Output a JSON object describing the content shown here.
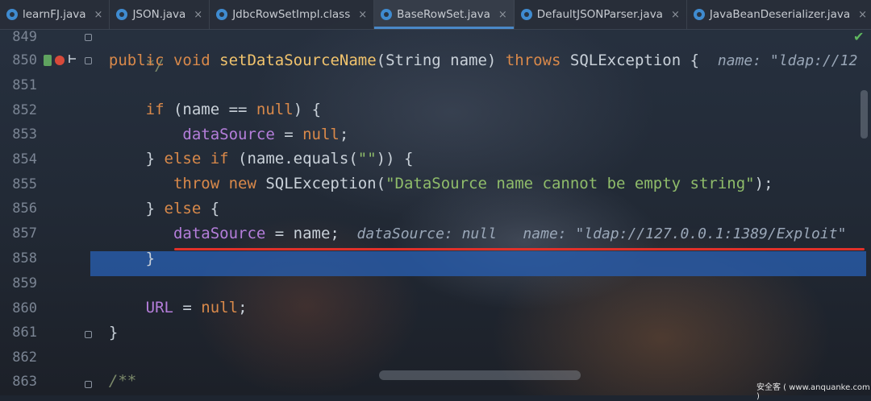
{
  "tabs": [
    {
      "label": "learnFJ.java",
      "active": false
    },
    {
      "label": "JSON.java",
      "active": false
    },
    {
      "label": "JdbcRowSetImpl.class",
      "active": false
    },
    {
      "label": "BaseRowSet.java",
      "active": true
    },
    {
      "label": "DefaultJSONParser.java",
      "active": false
    },
    {
      "label": "JavaBeanDeserializer.java",
      "active": false
    }
  ],
  "tab_close_glyph": "×",
  "line_numbers": [
    "849",
    "850",
    "851",
    "852",
    "853",
    "854",
    "855",
    "856",
    "857",
    "858",
    "859",
    "860",
    "861",
    "862",
    "863"
  ],
  "code": {
    "l849": "*/",
    "l850": {
      "kw1": "public void ",
      "fn": "setDataSourceName",
      "rest1": "(String name) ",
      "kw2": "throws ",
      "rest2": "SQLException {  ",
      "hint": "name: \"ldap://12"
    },
    "l852": {
      "kw": "if ",
      "a": "(name == ",
      "kw2": "null",
      "b": ") {"
    },
    "l853": {
      "fld": "dataSource",
      "a": " = ",
      "kw": "null",
      "b": ";"
    },
    "l854": {
      "a": "} ",
      "kw": "else if ",
      "b": "(name.equals(",
      "str": "\"\"",
      "c": ")) {"
    },
    "l855": {
      "kw": "throw new ",
      "a": "SQLException(",
      "str": "\"DataSource name cannot be empty string\"",
      "b": ");"
    },
    "l856": {
      "a": "} ",
      "kw": "else ",
      "b": "{"
    },
    "l857": {
      "fld": "dataSource",
      "a": " = name;",
      "hint": "  dataSource: null   name: \"ldap://127.0.0.1:1389/Exploit\""
    },
    "l858": "}",
    "l860": {
      "fld": "URL",
      "a": " = ",
      "kw": "null",
      "b": ";"
    },
    "l861": "}",
    "l863": "/**"
  },
  "watermark": "安全客 ( www.anquanke.com )",
  "colors": {
    "keyword": "#d9894a",
    "function": "#f2c46d",
    "field": "#b57edb",
    "string": "#8fbc6a",
    "highlight": "#2d5cab",
    "underline": "#e0302a"
  }
}
